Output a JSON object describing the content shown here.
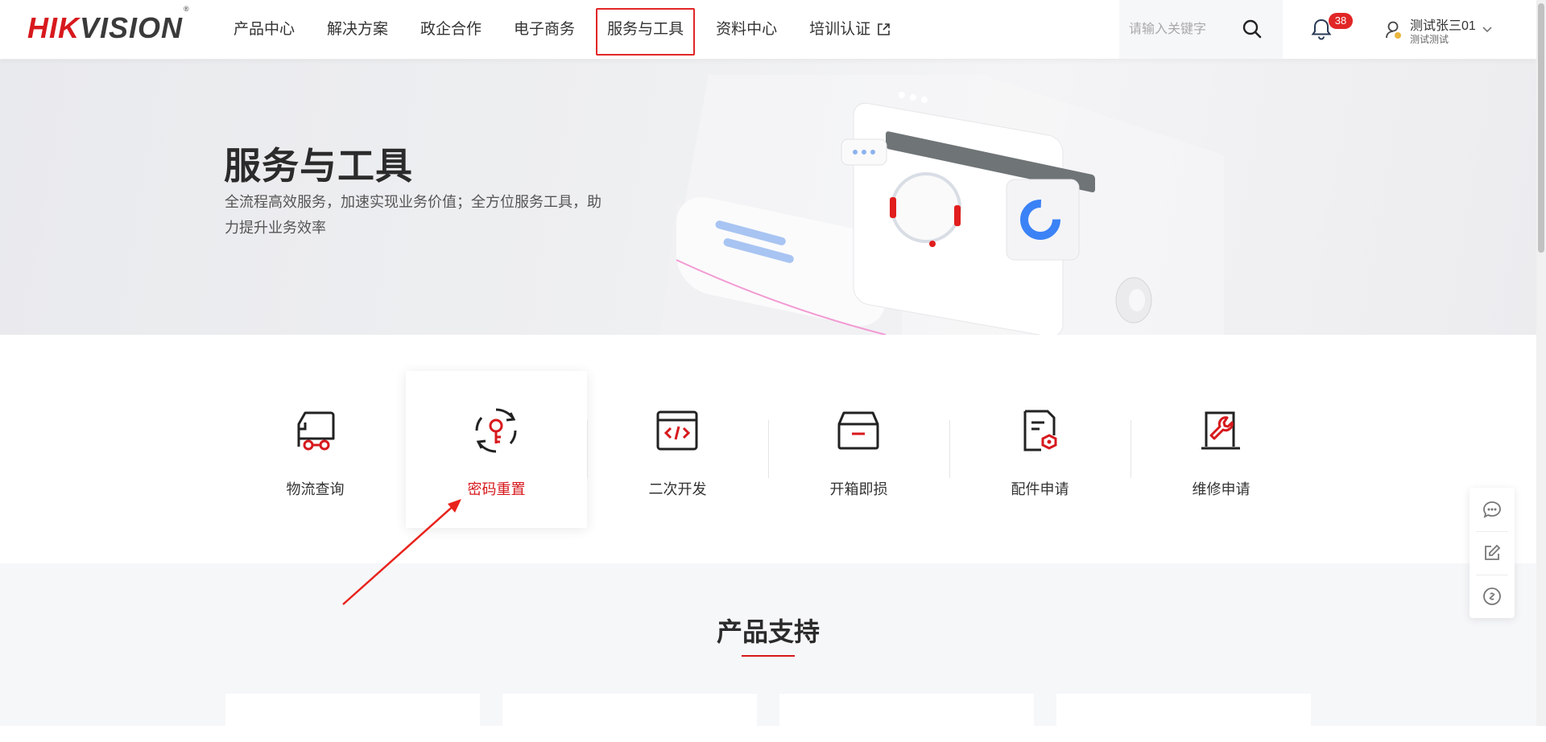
{
  "header": {
    "logo": {
      "primary": "HIK",
      "secondary": "VISION",
      "mark": "®"
    },
    "nav": [
      {
        "label": "产品中心"
      },
      {
        "label": "解决方案"
      },
      {
        "label": "政企合作"
      },
      {
        "label": "电子商务"
      },
      {
        "label": "服务与工具",
        "active": true
      },
      {
        "label": "资料中心"
      },
      {
        "label": "培训认证",
        "external": true
      }
    ],
    "search": {
      "placeholder": "请输入关键字",
      "icon": "search-icon"
    },
    "notifications": {
      "count": "38",
      "icon": "bell-icon"
    },
    "user": {
      "name": "测试张三01",
      "org": "测试测试",
      "icon": "user-icon"
    }
  },
  "banner": {
    "title": "服务与工具",
    "description": "全流程高效服务，加速实现业务价值；全方位服务工具，助力提升业务效率"
  },
  "services": [
    {
      "label": "物流查询",
      "icon": "truck-icon"
    },
    {
      "label": "密码重置",
      "icon": "key-reset-icon",
      "active": true
    },
    {
      "label": "二次开发",
      "icon": "code-window-icon"
    },
    {
      "label": "开箱即损",
      "icon": "box-icon"
    },
    {
      "label": "配件申请",
      "icon": "document-part-icon"
    },
    {
      "label": "维修申请",
      "icon": "wrench-icon"
    }
  ],
  "support": {
    "title": "产品支持"
  },
  "floatbar": [
    {
      "icon": "chat-service-icon"
    },
    {
      "icon": "edit-feedback-icon"
    },
    {
      "icon": "link-icon"
    }
  ],
  "colors": {
    "accent": "#d7191d",
    "highlight_border": "#e12626",
    "text": "#333333"
  }
}
